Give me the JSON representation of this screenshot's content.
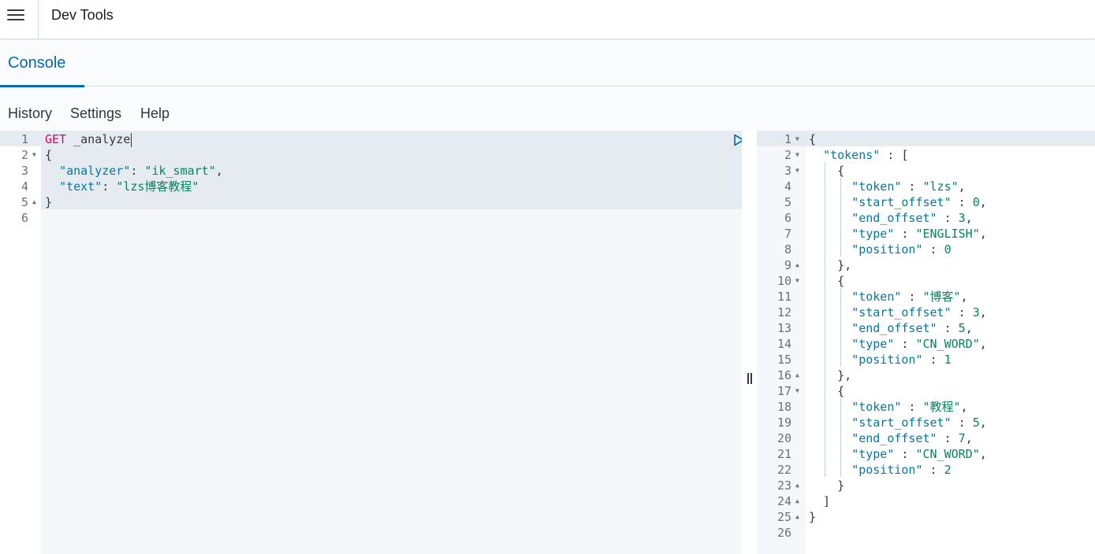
{
  "header": {
    "title": "Dev Tools",
    "menu_icon": "hamburger-menu-icon"
  },
  "tabs": [
    {
      "label": "Console",
      "active": true
    }
  ],
  "subnav": {
    "history": "History",
    "settings": "Settings",
    "help": "Help"
  },
  "request": {
    "method": "GET",
    "url": "_analyze",
    "line_numbers": [
      "1",
      "2",
      "3",
      "4",
      "5",
      "6"
    ],
    "lines": [
      "{",
      "  \"analyzer\": \"ik_smart\",",
      "  \"text\": \"lzs博客教程\"",
      "}"
    ],
    "analyzer_key": "\"analyzer\"",
    "analyzer_value": "\"ik_smart\"",
    "text_key": "\"text\"",
    "text_value": "\"lzs博客教程\"",
    "actions": {
      "play_icon": "play-icon",
      "wrench_icon": "wrench-icon"
    }
  },
  "response": {
    "line_numbers": [
      "1",
      "2",
      "3",
      "4",
      "5",
      "6",
      "7",
      "8",
      "9",
      "10",
      "11",
      "12",
      "13",
      "14",
      "15",
      "16",
      "17",
      "18",
      "19",
      "20",
      "21",
      "22",
      "23",
      "24",
      "25",
      "26"
    ],
    "tokens_key": "\"tokens\"",
    "tokens": [
      {
        "token": "\"lzs\"",
        "start_offset": "0",
        "end_offset": "3",
        "type": "\"ENGLISH\"",
        "position": "0"
      },
      {
        "token": "\"博客\"",
        "start_offset": "3",
        "end_offset": "5",
        "type": "\"CN_WORD\"",
        "position": "1"
      },
      {
        "token": "\"教程\"",
        "start_offset": "5",
        "end_offset": "7",
        "type": "\"CN_WORD\"",
        "position": "2"
      }
    ],
    "keys": {
      "token": "\"token\"",
      "start_offset": "\"start_offset\"",
      "end_offset": "\"end_offset\"",
      "type": "\"type\"",
      "position": "\"position\""
    }
  },
  "colors": {
    "accent": "#006bb4",
    "method": "#c80a68",
    "key": "#0079a5",
    "string": "#00875a"
  }
}
